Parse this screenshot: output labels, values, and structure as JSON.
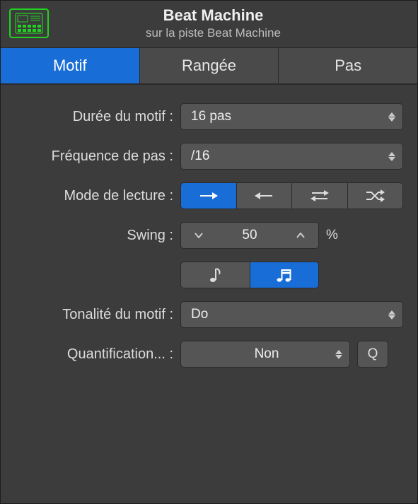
{
  "header": {
    "title": "Beat Machine",
    "subtitle": "sur la piste Beat Machine"
  },
  "tabs": {
    "motif": "Motif",
    "rangee": "Rangée",
    "pas": "Pas"
  },
  "labels": {
    "duree": "Durée du motif :",
    "freq": "Fréquence de pas :",
    "mode": "Mode de lecture :",
    "swing": "Swing :",
    "tonalite": "Tonalité du motif :",
    "quant": "Quantification... :"
  },
  "values": {
    "duree": "16 pas",
    "freq": "/16",
    "swing": "50",
    "pct": "%",
    "tonalite": "Do",
    "quant": "Non",
    "q_button": "Q"
  }
}
